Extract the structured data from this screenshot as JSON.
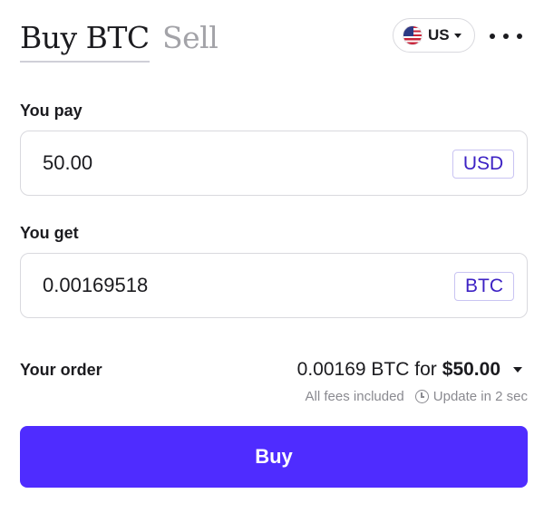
{
  "header": {
    "tabs": [
      {
        "label": "Buy BTC",
        "active": true
      },
      {
        "label": "Sell",
        "active": false
      }
    ],
    "country": {
      "code": "US",
      "flag_icon": "us-flag-icon"
    },
    "menu_icon": "more-horizontal-icon"
  },
  "pay": {
    "label": "You pay",
    "value": "50.00",
    "currency": "USD"
  },
  "get": {
    "label": "You get",
    "value": "0.00169518",
    "currency": "BTC"
  },
  "order": {
    "label": "Your order",
    "amount": "0.00169 BTC for",
    "price": "$50.00",
    "fees_note": "All fees included",
    "update_note": "Update in 2 sec"
  },
  "action": {
    "buy_label": "Buy"
  },
  "colors": {
    "accent": "#4f2cff",
    "currency_text": "#3d22c4",
    "muted_text": "#8a8a90"
  }
}
